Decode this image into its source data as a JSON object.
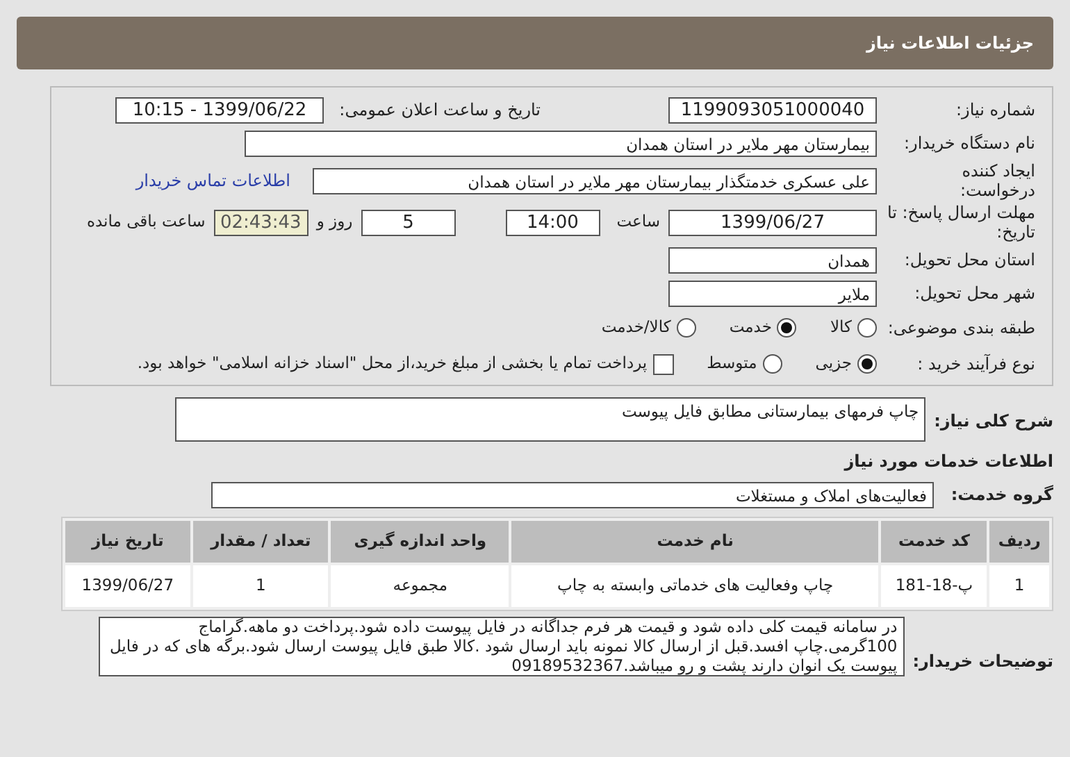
{
  "header": {
    "title": "جزئیات اطلاعات نیاز"
  },
  "need_number": {
    "label": "شماره نیاز:",
    "value": "1199093051000040"
  },
  "announce": {
    "label": "تاریخ و ساعت اعلان عمومی:",
    "value": "1399/06/22 - 10:15"
  },
  "buyer": {
    "label": "نام دستگاه خریدار:",
    "value": "بیمارستان مهر ملایر در استان همدان"
  },
  "requester": {
    "label": "ایجاد کننده درخواست:",
    "value": "علی عسکری خدمتگذار بیمارستان مهر ملایر در استان همدان",
    "contact_link": "اطلاعات تماس خریدار"
  },
  "deadline": {
    "label": "مهلت ارسال پاسخ: تا تاریخ:",
    "date": "1399/06/27",
    "time_label": "ساعت",
    "time": "14:00",
    "days": "5",
    "days_label": "روز و",
    "remaining": "02:43:43",
    "remaining_label": "ساعت باقی مانده"
  },
  "province": {
    "label": "استان محل تحویل:",
    "value": "همدان"
  },
  "city": {
    "label": "شهر محل تحویل:",
    "value": "ملایر"
  },
  "category": {
    "label": "طبقه بندی موضوعی:",
    "options": [
      {
        "label": "کالا",
        "selected": false
      },
      {
        "label": "خدمت",
        "selected": true
      },
      {
        "label": "کالا/خدمت",
        "selected": false
      }
    ]
  },
  "process": {
    "label": "نوع فرآیند خرید :",
    "options": [
      {
        "label": "جزیی",
        "selected": true
      },
      {
        "label": "متوسط",
        "selected": false
      }
    ],
    "checkbox": {
      "label": "پرداخت تمام یا بخشی از مبلغ خرید،از محل \"اسناد خزانه اسلامی\" خواهد بود.",
      "checked": false
    }
  },
  "description": {
    "label": "شرح کلی نیاز:",
    "value": "چاپ فرمهای بیمارستانی مطابق فایل پیوست"
  },
  "services_heading": "اطلاعات خدمات مورد نیاز",
  "service_group": {
    "label": "گروه خدمت:",
    "value": "فعالیت‌های  املاک و مستغلات"
  },
  "table": {
    "columns": [
      "ردیف",
      "کد خدمت",
      "نام خدمت",
      "واحد اندازه گیری",
      "تعداد / مقدار",
      "تاریخ نیاز"
    ],
    "rows": [
      [
        "1",
        "پ-18-181",
        "چاپ وفعالیت های خدماتی وابسته به چاپ",
        "مجموعه",
        "1",
        "1399/06/27"
      ]
    ]
  },
  "buyer_notes": {
    "label": "توضیحات خریدار:",
    "value": "در سامانه قیمت کلی داده شود و قیمت هر فرم جداگانه در فایل پیوست داده شود.پرداخت دو ماهه.گراماج 100گرمی.چاپ افسد.قبل از ارسال کالا نمونه باید ارسال شود .کالا طبق فایل پیوست ارسال شود.برگه های که در فایل پیوست یک انوان دارند پشت و رو میباشد.09189532367"
  }
}
